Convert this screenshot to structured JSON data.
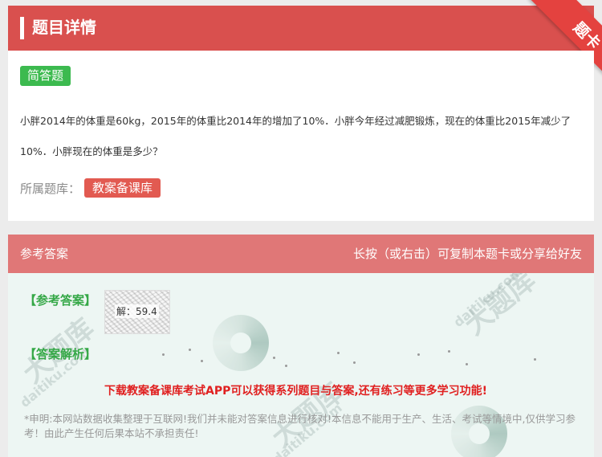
{
  "header": {
    "title": "题目详情",
    "corner_label": "题卡"
  },
  "question": {
    "type_badge": "简答题",
    "text": "小胖2014年的体重是60kg，2015年的体重比2014年的增加了10%．小胖今年经过减肥锻炼，现在的体重比2015年减少了10%．小胖现在的体重是多少？",
    "bank_label": "所属题库：",
    "bank_name": "教案备课库"
  },
  "answer_bar": {
    "title": "参考答案",
    "hint": "长按（或右击）可复制本题卡或分享给好友"
  },
  "answer": {
    "reference_title": "【参考答案】",
    "reference_image_text": "解：59.4",
    "analysis_title": "【答案解析】",
    "promo": "下载教案备课库考试APP可以获得系列题目与答案,还有练习等更多学习功能!",
    "disclaimer": "*申明:本网站数据收集整理于互联网!我们并未能对答案信息进行核对!本信息不能用于生产、生活、考试等情境中,仅供学习参考！由此产生任何后果本站不承担责任!"
  },
  "watermarks": [
    "大题库",
    "daitiku.com",
    "大题库",
    "daitiku.com",
    "大题库",
    "daitiku.com"
  ],
  "colors": {
    "header_red": "#d9504e",
    "type_green": "#3cba4f",
    "bank_red": "#e25a51",
    "answer_bar": "#e07777",
    "answer_bg": "#edf6f3",
    "section_green": "#35a847",
    "promo_red": "#e02020"
  }
}
